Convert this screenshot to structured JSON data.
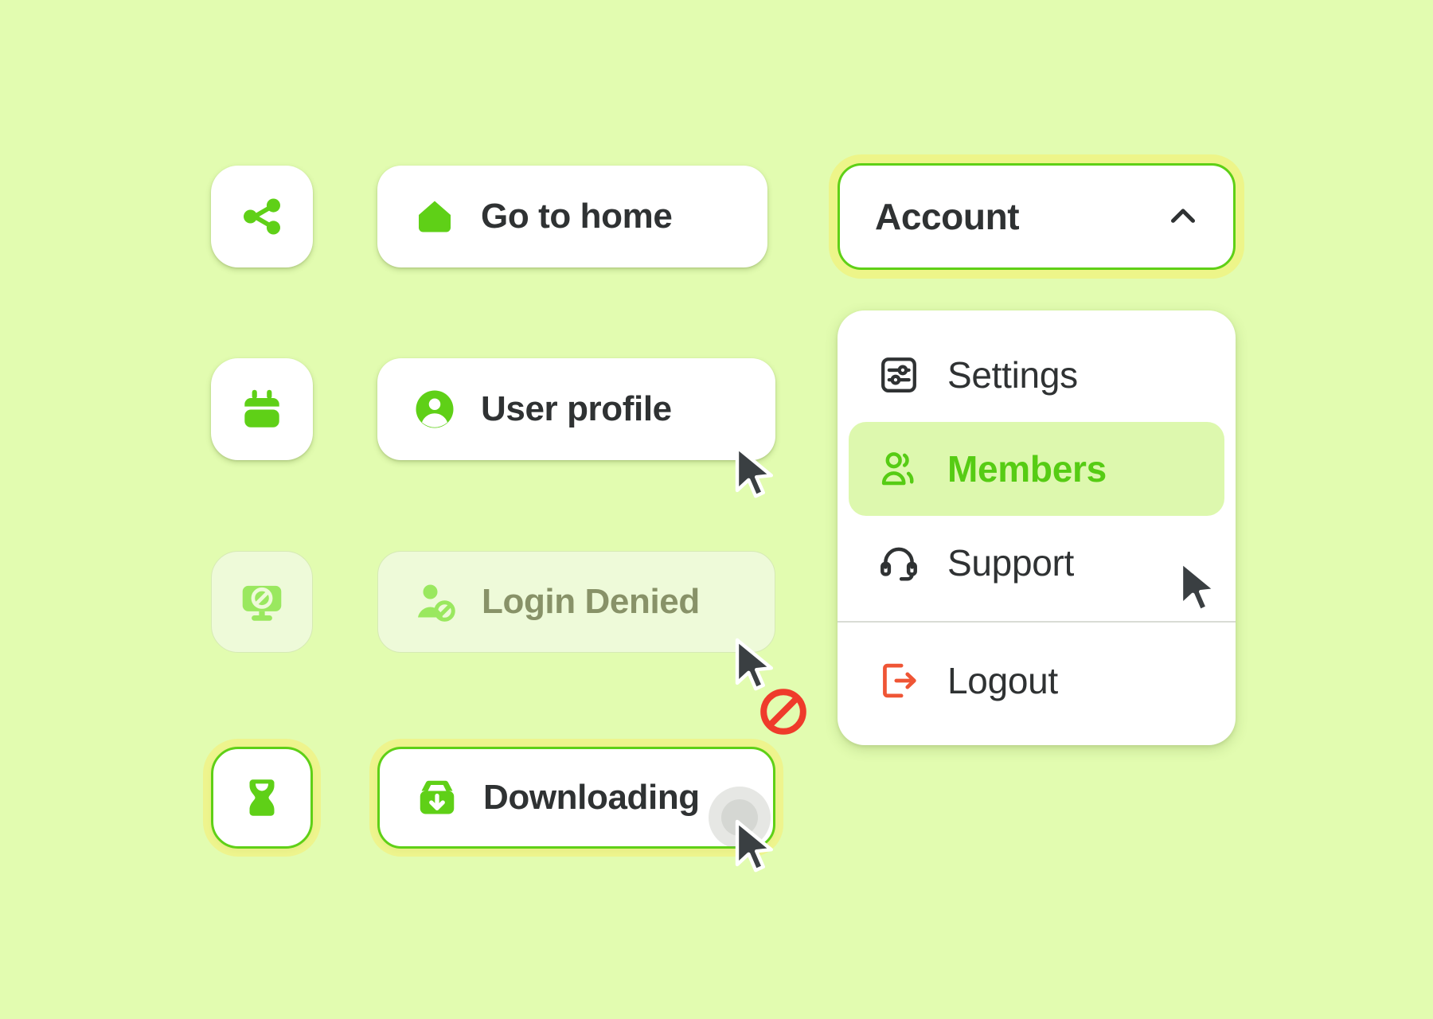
{
  "theme": {
    "page_background": "#e2fcb0",
    "accent_green": "#5fd017",
    "accent_green_bright": "#56cc14",
    "surface_white": "#ffffff",
    "text_dark": "#2f3233",
    "text_disabled": "#889268",
    "disabled_surface": "#eefad9",
    "highlight_row": "#ddf8ae",
    "focus_glow_yellow": "#f0f280",
    "logout_red": "#ef5535",
    "divider_gray": "#d9dcd5"
  },
  "icon_tiles": [
    {
      "name": "share-icon",
      "label": "Share",
      "state": "default"
    },
    {
      "name": "calendar-icon",
      "label": "Calendar",
      "state": "default"
    },
    {
      "name": "screen-share-off-icon",
      "label": "Screen share off",
      "state": "disabled"
    },
    {
      "name": "hourglass-icon",
      "label": "Hourglass",
      "state": "focused"
    }
  ],
  "buttons": [
    {
      "label": "Go to home",
      "icon": "home-icon",
      "state": "default",
      "cursor": "none"
    },
    {
      "label": "User profile",
      "icon": "user-circle-icon",
      "state": "default",
      "cursor": "arrow"
    },
    {
      "label": "Login Denied",
      "icon": "user-blocked-icon",
      "state": "disabled",
      "cursor": "arrow-blocked"
    },
    {
      "label": "Downloading",
      "icon": "download-box-icon",
      "state": "focused",
      "cursor": "arrow-pressed"
    }
  ],
  "dropdown": {
    "trigger_label": "Account",
    "trigger_icon": "chevron-up-icon",
    "expanded": true,
    "items": [
      {
        "label": "Settings",
        "icon": "sliders-square-icon",
        "active": false,
        "tone": "default"
      },
      {
        "label": "Members",
        "icon": "users-icon",
        "active": true,
        "tone": "accent"
      },
      {
        "label": "Support",
        "icon": "headset-icon",
        "active": false,
        "tone": "default"
      },
      {
        "label": "Logout",
        "icon": "logout-icon",
        "active": false,
        "tone": "danger"
      }
    ],
    "divider_before_index": 3
  }
}
